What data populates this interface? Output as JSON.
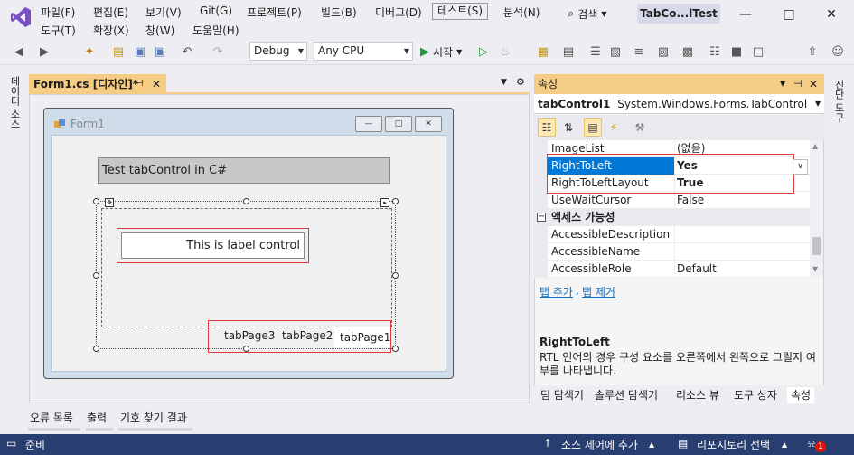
{
  "menu": {
    "file": "파일(F)",
    "edit": "편집(E)",
    "view": "보기(V)",
    "git": "Git(G)",
    "project": "프로젝트(P)",
    "build": "빌드(B)",
    "debug": "디버그(D)",
    "test": "테스트(S)",
    "analyze": "분석(N)",
    "tools": "도구(T)",
    "extensions": "확장(X)",
    "window": "창(W)",
    "help": "도움말(H)",
    "search": "검색",
    "solution_title": "TabCo...lTest"
  },
  "toolbar": {
    "config": "Debug",
    "platform": "Any CPU",
    "start": "시작"
  },
  "left_strip": {
    "label": "데이터 소스"
  },
  "right_strip": {
    "label": "진단 도구"
  },
  "document": {
    "tab_label": "Form1.cs [디자인]*"
  },
  "form": {
    "title": "Form1",
    "title_label": "Test tabControl in C#",
    "label_control": "This is label control",
    "tab_pages": [
      "tabPage3",
      "tabPage2",
      "tabPage1"
    ]
  },
  "properties": {
    "header": "속성",
    "object_name": "tabControl1",
    "object_type": "System.Windows.Forms.TabControl",
    "rows": [
      {
        "name": "ImageList",
        "value": "(없음)"
      },
      {
        "name": "RightToLeft",
        "value": "Yes"
      },
      {
        "name": "RightToLeftLayout",
        "value": "True"
      },
      {
        "name": "UseWaitCursor",
        "value": "False"
      }
    ],
    "category": "액세스 가능성",
    "category_rows": [
      {
        "name": "AccessibleDescription",
        "value": ""
      },
      {
        "name": "AccessibleName",
        "value": ""
      },
      {
        "name": "AccessibleRole",
        "value": "Default"
      }
    ],
    "link_add_tab": "탭 추가",
    "link_separator": ",",
    "link_remove_tab": "탭 제거",
    "desc_title": "RightToLeft",
    "desc_text": "RTL 언어의 경우 구성 요소를 오른쪽에서 왼쪽으로 그릴지 여부를 나타냅니다.",
    "bottom_tabs": [
      "팀 탐색기",
      "솔루션 탐색기",
      "리소스 뷰",
      "도구 상자",
      "속성"
    ]
  },
  "bottom_tabs": [
    "오류 목록",
    "출력",
    "기호 찾기 결과"
  ],
  "status": {
    "ready": "준비",
    "source_control": "소스 제어에 추가",
    "repository": "리포지토리 선택",
    "notifications": "1"
  },
  "colors": {
    "accent_tab": "#f5cc84",
    "status_bar": "#283e70",
    "selection": "#0078d7",
    "highlight_red": "#d93c3c"
  }
}
